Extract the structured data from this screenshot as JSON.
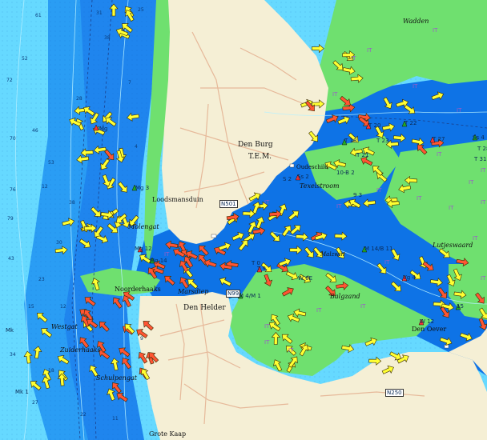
{
  "map": {
    "type": "nautical-chart",
    "colors": {
      "deep_water": "#66d9ff",
      "mid_water": "#2a9df4",
      "shallow_water": "#0e73e6",
      "tidal_flat": "#6fe06f",
      "land": "#f5efd5",
      "road": "#e6b99a",
      "depth_contour": "#b5f0ff",
      "current_flood": "#ffff33",
      "current_ebb": "#ff5533"
    },
    "places": [
      {
        "id": "wadden",
        "text": "Wadden",
        "style": "italic"
      },
      {
        "id": "den-burg",
        "text": "Den Burg",
        "style": "normal"
      },
      {
        "id": "tem",
        "text": "T.E.M.",
        "style": "normal"
      },
      {
        "id": "loodsmansduin",
        "text": "Loodsmansduin",
        "style": "normal"
      },
      {
        "id": "molengat",
        "text": "Molengat",
        "style": "italic"
      },
      {
        "id": "noorderhaaks",
        "text": "Noorderhaaks",
        "style": "normal"
      },
      {
        "id": "den-helder",
        "text": "Den Helder",
        "style": "normal"
      },
      {
        "id": "marsdiep",
        "text": "Marsdiep",
        "style": "italic"
      },
      {
        "id": "texelstroom",
        "text": "Texelstroom",
        "style": "italic"
      },
      {
        "id": "balgzand",
        "text": "Balgzand",
        "style": "italic"
      },
      {
        "id": "lutjeswaard",
        "text": "Lutjeswaard",
        "style": "italic"
      },
      {
        "id": "den-oever",
        "text": "Den Oever",
        "style": "normal"
      },
      {
        "id": "westgat",
        "text": "Westgat",
        "style": "italic"
      },
      {
        "id": "zuiderhaaks",
        "text": "Zuiderhaaks",
        "style": "italic"
      },
      {
        "id": "schulpengat",
        "text": "Schulpengat",
        "style": "italic"
      },
      {
        "id": "grote-kaap",
        "text": "Grote Kaap",
        "style": "normal"
      },
      {
        "id": "malzwin",
        "text": "Malzwin",
        "style": "italic"
      },
      {
        "id": "oude-schild",
        "text": "Oudeschild",
        "style": "normal"
      }
    ],
    "buoys": [
      "Mg",
      "Mg 3",
      "Mg 12",
      "Mg 14",
      "T 20",
      "T 22",
      "T 27",
      "T 18",
      "T 23",
      "T 21",
      "T 9",
      "T 0",
      "M 14/B 11",
      "W 12",
      "15",
      "Ss 2",
      "Ss 4",
      "Mk",
      "Mk 1",
      "W 6E",
      "M 4/M 1",
      "Vg 4",
      "T 28",
      "T 31",
      "9 3",
      "10-B 2",
      "S 2"
    ],
    "road_labels": [
      "N501",
      "N99",
      "N250"
    ],
    "depths": [
      "61",
      "31",
      "25",
      "38",
      "52",
      "72",
      "76",
      "79",
      "46",
      "53",
      "38",
      "30",
      "23",
      "15",
      "12",
      "18",
      "27",
      "22",
      "11",
      "7",
      "4",
      "70",
      "43",
      "34",
      "28",
      "12",
      "9"
    ],
    "current_arrows": 230,
    "tidal_flat_marks": 24
  }
}
